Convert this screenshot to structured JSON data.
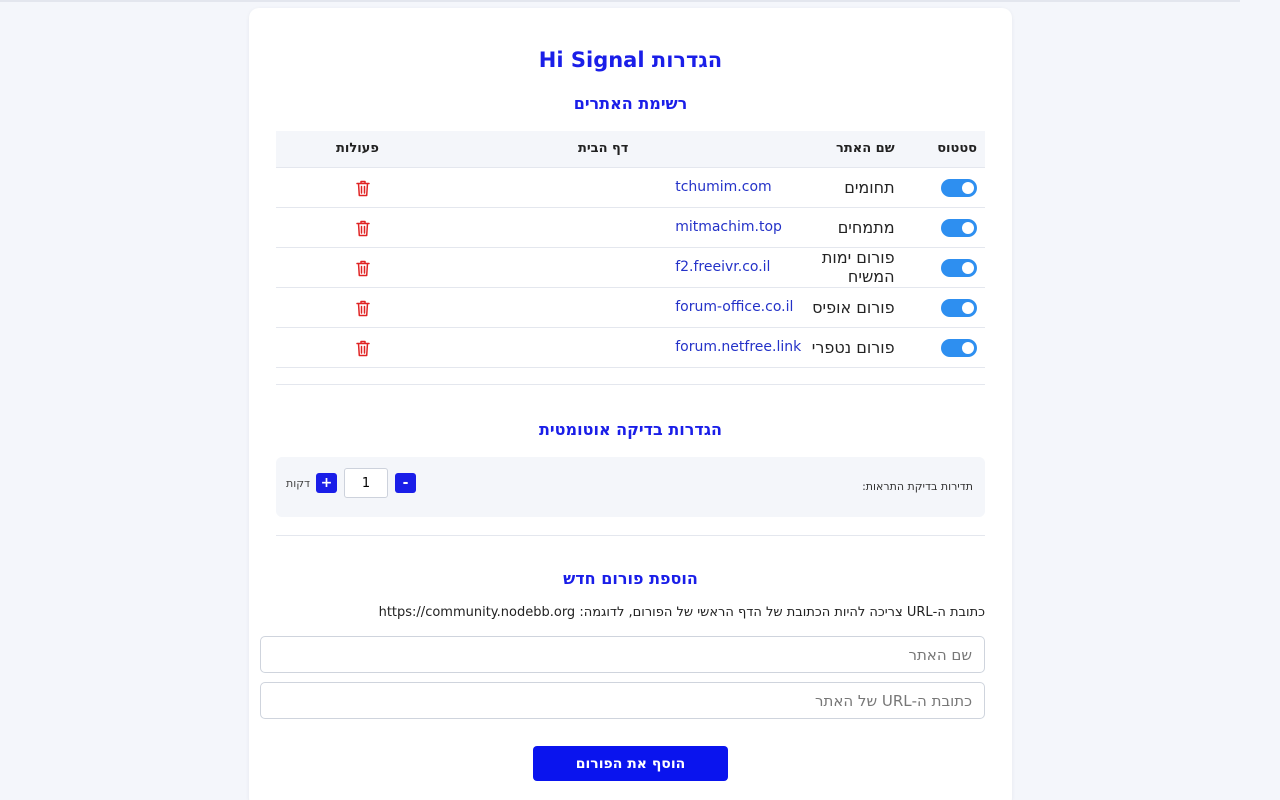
{
  "app": {
    "title": "הגדרות Hi Signal"
  },
  "sites": {
    "title": "רשימת האתרים",
    "columns": {
      "status": "סטטוס",
      "name": "שם האתר",
      "home": "דף הבית",
      "actions": "פעולות"
    },
    "rows": [
      {
        "name": "תחומים",
        "home": "tchumim.com",
        "enabled": true
      },
      {
        "name": "מתמחים",
        "home": "mitmachim.top",
        "enabled": true
      },
      {
        "name": "פורום ימות המשיח",
        "home": "f2.freeivr.co.il",
        "enabled": true
      },
      {
        "name": "פורום אופיס",
        "home": "forum-office.co.il",
        "enabled": true
      },
      {
        "name": "פורום נטפרי",
        "home": "forum.netfree.link",
        "enabled": true
      }
    ]
  },
  "auto_check": {
    "title": "הגדרות בדיקה אוטומטית",
    "label": "תדירות בדיקת התראות:",
    "value": "1",
    "unit": "דקות",
    "minus_label": "-",
    "plus_label": "+"
  },
  "add_forum": {
    "title": "הוספת פורום חדש",
    "hint": "כתובת ה-URL צריכה להיות הכתובת של הדף הראשי של הפורום, לדוגמה: https://community.nodebb.org",
    "name_placeholder": "שם האתר",
    "url_placeholder": "כתובת ה-URL של האתר",
    "button_label": "הוסף את הפורום"
  },
  "colors": {
    "accent": "#1a1ee8",
    "toggle_on": "#2e8ff0",
    "danger": "#e02424",
    "link": "#2432c8"
  }
}
